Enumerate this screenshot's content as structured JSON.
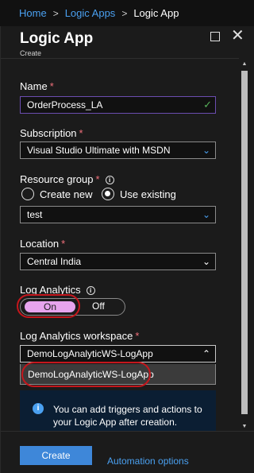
{
  "breadcrumb": {
    "home": "Home",
    "logic_apps": "Logic Apps",
    "current": "Logic App",
    "separator": ">"
  },
  "header": {
    "title": "Logic App",
    "subtitle": "Create"
  },
  "form": {
    "name": {
      "label": "Name",
      "required_mark": "*",
      "value": "OrderProcess_LA"
    },
    "subscription": {
      "label": "Subscription",
      "required_mark": "*",
      "value": "Visual Studio Ultimate with MSDN"
    },
    "resource_group": {
      "label": "Resource group",
      "required_mark": "*",
      "options": {
        "create_new": "Create new",
        "use_existing": "Use existing"
      },
      "selected": "use_existing",
      "value": "test"
    },
    "location": {
      "label": "Location",
      "required_mark": "*",
      "value": "Central India"
    },
    "log_analytics": {
      "label": "Log Analytics",
      "on_label": "On",
      "off_label": "Off",
      "state": "On"
    },
    "workspace": {
      "label": "Log Analytics workspace",
      "required_mark": "*",
      "value": "DemoLogAnalyticWS-LogApp",
      "dropdown_open": true,
      "options": [
        "DemoLogAnalyticWS-LogApp"
      ]
    }
  },
  "info": {
    "message": "You can add triggers and actions to your Logic App after creation."
  },
  "footer": {
    "create_label": "Create",
    "automation_label": "Automation options"
  },
  "colors": {
    "accent": "#3e87d9",
    "link": "#4aa0f0",
    "toggle_on": "#e7a4ee",
    "required": "#f1707b",
    "annotation": "#c4161c",
    "valid_check": "#57b15a"
  },
  "icons": [
    "chevron-right-icon",
    "maximize-icon",
    "close-icon",
    "checkmark-icon",
    "info-icon",
    "chevron-down-icon",
    "chevron-up-icon"
  ]
}
